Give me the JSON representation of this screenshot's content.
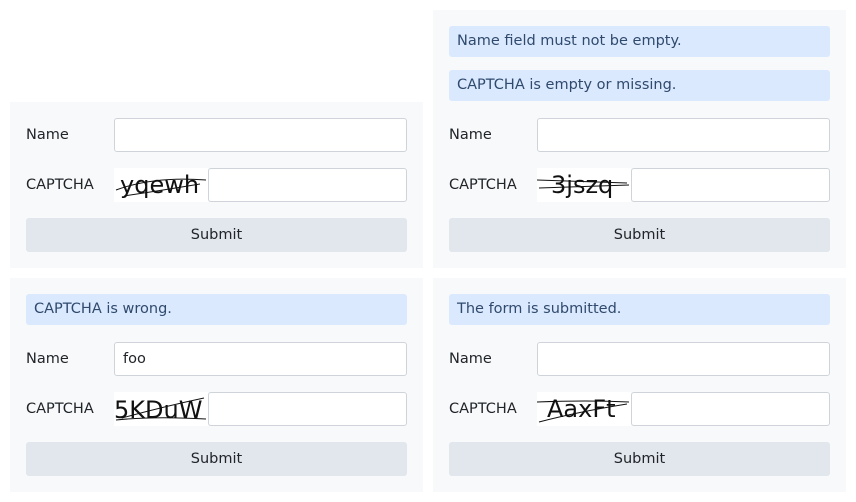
{
  "labels": {
    "name": "Name",
    "captcha": "CAPTCHA",
    "submit": "Submit"
  },
  "forms": [
    {
      "messages": [],
      "name_value": "",
      "captcha_text": "yqewh",
      "captcha_value": ""
    },
    {
      "messages": [
        "Name field must not be empty.",
        "CAPTCHA is empty or missing."
      ],
      "name_value": "",
      "captcha_text": "3jszq",
      "captcha_value": ""
    },
    {
      "messages": [
        "CAPTCHA is wrong."
      ],
      "name_value": "foo",
      "captcha_text": "5KDuW",
      "captcha_value": ""
    },
    {
      "messages": [
        "The form is submitted."
      ],
      "name_value": "",
      "captcha_text": "AaxFt",
      "captcha_value": ""
    }
  ],
  "colors": {
    "panel_bg": "#f8f9fa",
    "alert_bg": "#dbe9fe",
    "alert_text": "#2f4a6d",
    "button_bg": "#e2e6ed"
  }
}
